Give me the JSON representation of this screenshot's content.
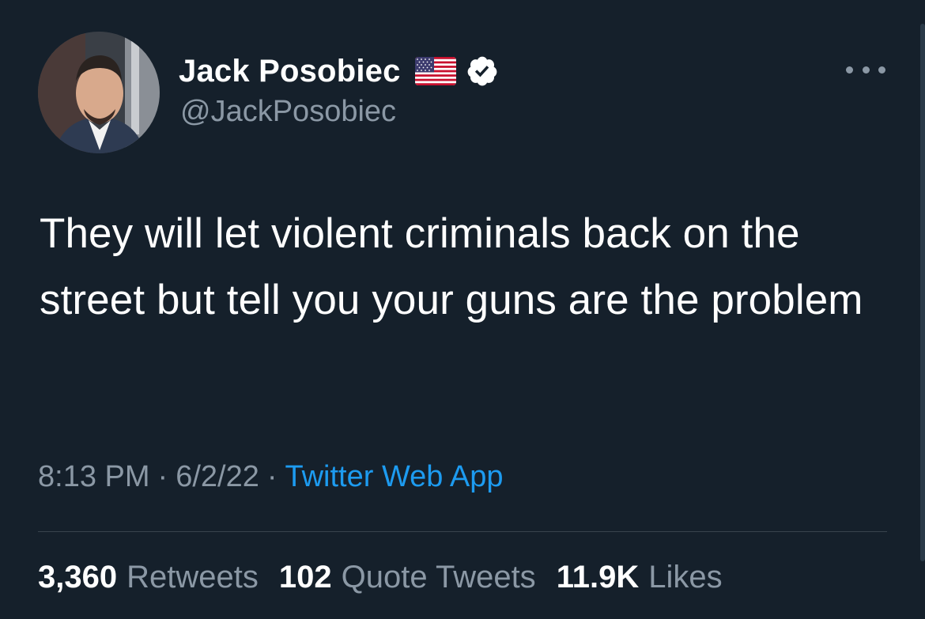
{
  "user": {
    "display_name": "Jack Posobiec",
    "handle": "@JackPosobiec",
    "name_emoji": "us-flag-icon",
    "verified_icon": "verified-badge-icon"
  },
  "tweet": {
    "text": "They will let violent criminals back on the street but tell you your guns are the problem",
    "time": "8:13 PM",
    "date": "6/2/22",
    "source": "Twitter Web App",
    "separator": "·"
  },
  "stats": {
    "retweets_count": "3,360",
    "retweets_label": "Retweets",
    "quotes_count": "102",
    "quotes_label": "Quote Tweets",
    "likes_count": "11.9K",
    "likes_label": "Likes"
  },
  "menu_icon": "more-options-icon",
  "colors": {
    "background": "#15202b",
    "text_primary": "#ffffff",
    "text_secondary": "#8b98a5",
    "accent": "#1d9bf0",
    "divider": "#38444d"
  }
}
